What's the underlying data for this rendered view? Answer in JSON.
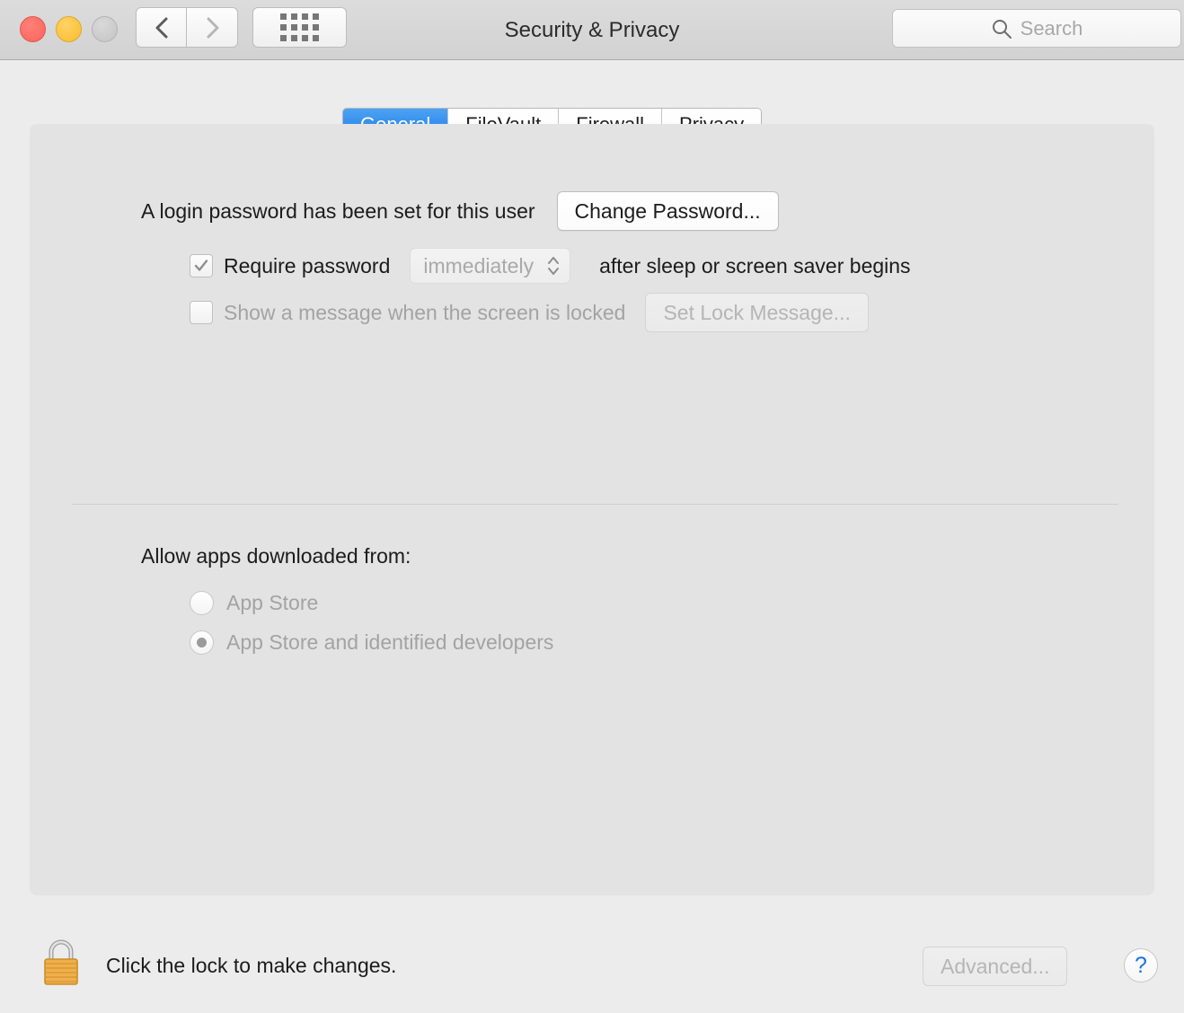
{
  "window": {
    "title": "Security & Privacy",
    "traffic_lights": [
      "close",
      "minimize",
      "zoom"
    ],
    "nav": {
      "back": "back-chevron",
      "forward": "forward-chevron"
    },
    "show_all": "grid-icon",
    "search": {
      "placeholder": "Search",
      "value": "",
      "icon": "search-icon"
    }
  },
  "tabs": [
    {
      "label": "General",
      "selected": true
    },
    {
      "label": "FileVault",
      "selected": false
    },
    {
      "label": "Firewall",
      "selected": false
    },
    {
      "label": "Privacy",
      "selected": false
    }
  ],
  "general": {
    "password_status": "A login password has been set for this user",
    "change_password_label": "Change Password...",
    "require_password": {
      "label": "Require password",
      "checked": true,
      "enabled": false,
      "delay_value": "immediately",
      "suffix": "after sleep or screen saver begins"
    },
    "lock_message": {
      "label": "Show a message when the screen is locked",
      "checked": false,
      "enabled": false,
      "button_label": "Set Lock Message..."
    },
    "allow_apps": {
      "heading": "Allow apps downloaded from:",
      "options": [
        {
          "label": "App Store",
          "selected": false
        },
        {
          "label": "App Store and identified developers",
          "selected": true
        }
      ]
    }
  },
  "footer": {
    "lock_icon": "closed-padlock-icon",
    "lock_note": "Click the lock to make changes.",
    "advanced_label": "Advanced...",
    "help_label": "?"
  },
  "colors": {
    "accent_blue": "#1878e8",
    "window_bg": "#ececec",
    "panel_bg": "#e3e3e3",
    "toolbar_bg": "#d6d6d6",
    "disabled_text": "#a3a3a3",
    "lock_gold": "#f0b049"
  }
}
